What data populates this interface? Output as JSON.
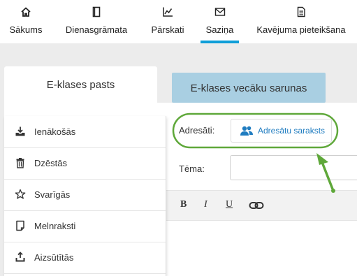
{
  "topnav": {
    "items": [
      {
        "label": "Sākums",
        "icon": "home-icon"
      },
      {
        "label": "Dienasgrāmata",
        "icon": "book-icon"
      },
      {
        "label": "Pārskati",
        "icon": "chart-icon"
      },
      {
        "label": "Saziņa",
        "icon": "envelope-icon",
        "active": true
      },
      {
        "label": "Kavējuma pieteikšana",
        "icon": "document-icon"
      }
    ]
  },
  "tabs": {
    "mail": "E-klases pasts",
    "parents": "E-klases vecāku sarunas"
  },
  "sidebar": {
    "items": [
      {
        "label": "Ienākošās",
        "icon": "inbox-icon"
      },
      {
        "label": "Dzēstās",
        "icon": "trash-icon"
      },
      {
        "label": "Svarīgās",
        "icon": "star-icon"
      },
      {
        "label": "Melnraksti",
        "icon": "draft-icon"
      },
      {
        "label": "Aizsūtītās",
        "icon": "upload-icon"
      }
    ]
  },
  "compose": {
    "recipients_label": "Adresāti:",
    "recipients_button": "Adresātu saraksts",
    "subject_label": "Tēma:",
    "subject_value": ""
  },
  "editor": {
    "bold": "B",
    "italic": "I",
    "underline": "U"
  },
  "colors": {
    "accent": "#0f9ed8",
    "annotation": "#5fa83a",
    "link": "#1f7cc0"
  }
}
